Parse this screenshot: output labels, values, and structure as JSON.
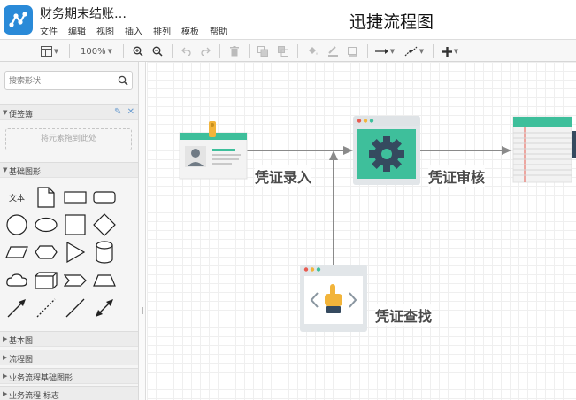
{
  "header": {
    "doc_title": "财务期末结账…",
    "app_title": "迅捷流程图"
  },
  "menu": [
    "文件",
    "编辑",
    "视图",
    "插入",
    "排列",
    "模板",
    "帮助"
  ],
  "toolbar": {
    "zoom": "100%"
  },
  "sidebar": {
    "search_placeholder": "搜索形状",
    "scratchpad": {
      "label": "便签簿",
      "drop_hint": "将元素拖到此处"
    },
    "basic_shapes": {
      "label": "基础图形",
      "text_shape": "文本"
    },
    "collapsed_sections": [
      "基本图",
      "流程图",
      "业务流程基础图形",
      "业务流程 标志"
    ]
  },
  "diagram": {
    "labels": {
      "entry": "凭证录入",
      "review": "凭证审核",
      "search": "凭证查找"
    }
  },
  "colors": {
    "accent": "#2a8ad8",
    "teal": "#3ebf9b",
    "gear": "#354a5f",
    "arrow": "#8a8a8a",
    "hand": "#f2b43a"
  }
}
